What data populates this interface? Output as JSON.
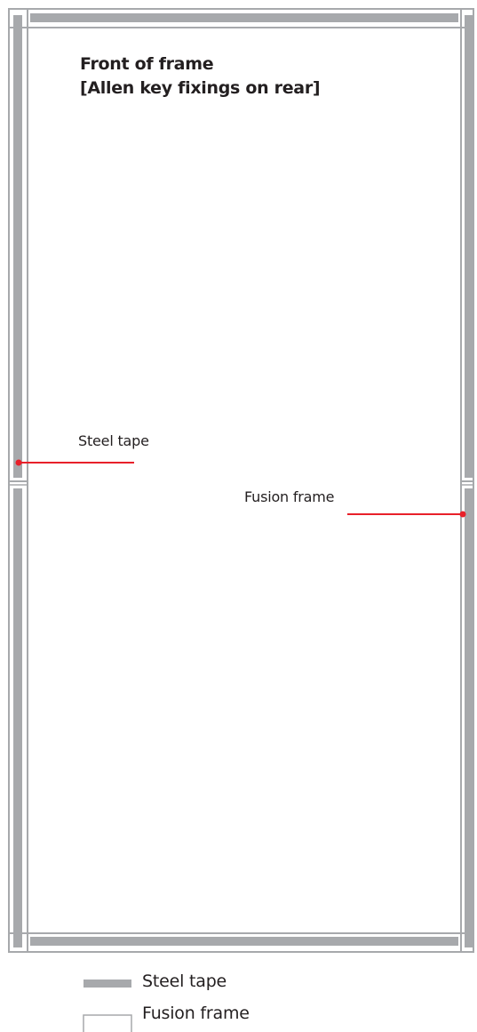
{
  "title": {
    "line1": "Front of frame",
    "line2": "[Allen key fixings on rear]"
  },
  "callouts": {
    "steel_tape": "Steel tape",
    "fusion_frame": "Fusion frame"
  },
  "legend": {
    "steel_tape": "Steel tape",
    "fusion_frame": "Fusion frame"
  },
  "colors": {
    "frame_outline": "#a7a9ac",
    "steel_tape": "#a7a9ac",
    "callout": "#e8202a",
    "text": "#231f20"
  }
}
